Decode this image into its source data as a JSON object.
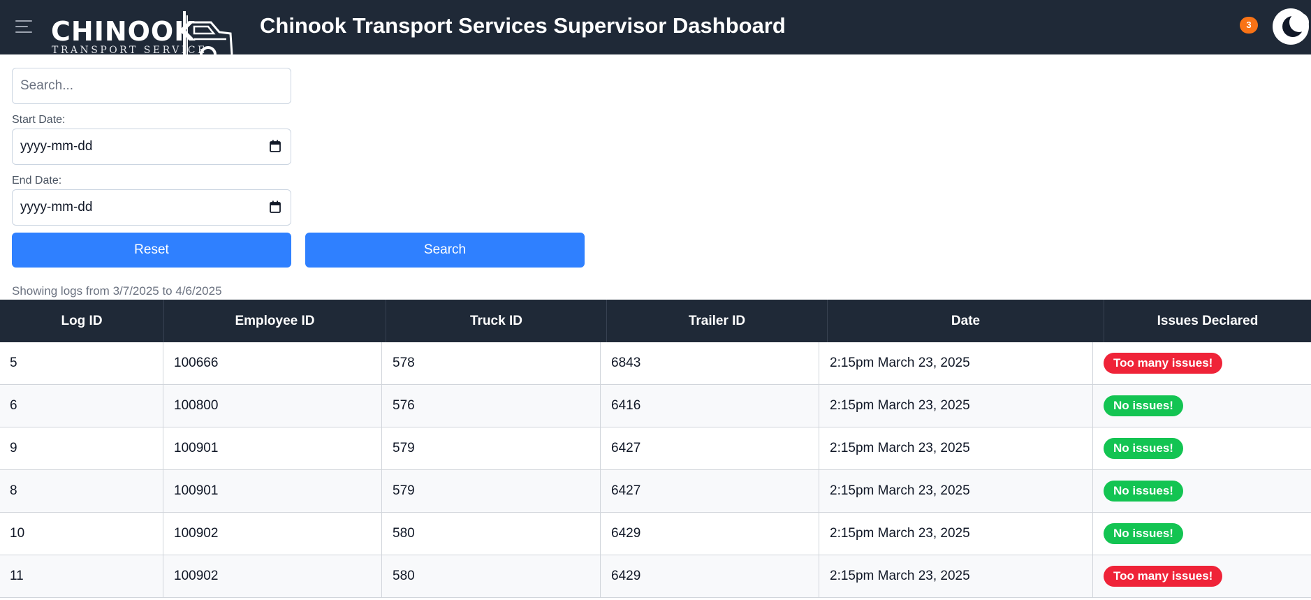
{
  "header": {
    "logo_main": "CHINOOK",
    "logo_sub": "TRANSPORT SERVICE",
    "title": "Chinook Transport Services Supervisor Dashboard",
    "notification_count": "3",
    "icons": [
      "hamburger-menu-icon",
      "truck-logo-icon",
      "notification-badge",
      "moon-icon"
    ],
    "colors": {
      "header_bg": "#1f2937",
      "badge": "#f97316"
    }
  },
  "filters": {
    "search_placeholder": "Search...",
    "start_date_label": "Start Date:",
    "start_date_value": "yyyy-mm-dd",
    "end_date_label": "End Date:",
    "end_date_value": "yyyy-mm-dd",
    "reset_label": "Reset",
    "search_label": "Search",
    "colors": {
      "button": "#2f80ff"
    }
  },
  "range_text": "Showing logs from 3/7/2025 to 4/6/2025",
  "table": {
    "columns": [
      "Log ID",
      "Employee ID",
      "Truck ID",
      "Trailer ID",
      "Date",
      "Issues Declared"
    ],
    "rows": [
      {
        "log_id": "5",
        "employee_id": "100666",
        "truck_id": "578",
        "trailer_id": "6843",
        "date": "2:15pm March 23, 2025",
        "issues": "Too many issues!",
        "status": "bad"
      },
      {
        "log_id": "6",
        "employee_id": "100800",
        "truck_id": "576",
        "trailer_id": "6416",
        "date": "2:15pm March 23, 2025",
        "issues": "No issues!",
        "status": "good"
      },
      {
        "log_id": "9",
        "employee_id": "100901",
        "truck_id": "579",
        "trailer_id": "6427",
        "date": "2:15pm March 23, 2025",
        "issues": "No issues!",
        "status": "good"
      },
      {
        "log_id": "8",
        "employee_id": "100901",
        "truck_id": "579",
        "trailer_id": "6427",
        "date": "2:15pm March 23, 2025",
        "issues": "No issues!",
        "status": "good"
      },
      {
        "log_id": "10",
        "employee_id": "100902",
        "truck_id": "580",
        "trailer_id": "6429",
        "date": "2:15pm March 23, 2025",
        "issues": "No issues!",
        "status": "good"
      },
      {
        "log_id": "11",
        "employee_id": "100902",
        "truck_id": "580",
        "trailer_id": "6429",
        "date": "2:15pm March 23, 2025",
        "issues": "Too many issues!",
        "status": "bad"
      }
    ],
    "colors": {
      "bad": "#ef2338",
      "good": "#13c452"
    }
  }
}
